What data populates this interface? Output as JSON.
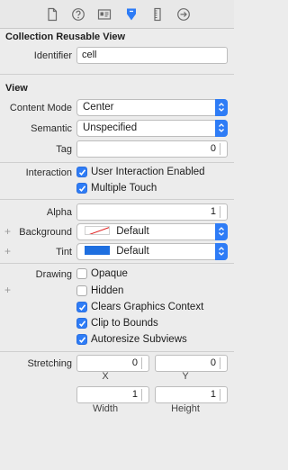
{
  "toolbar": {
    "icons": [
      "file-inspector-icon",
      "quick-help-icon",
      "identity-inspector-icon",
      "attributes-inspector-icon",
      "size-inspector-icon",
      "connections-inspector-icon"
    ],
    "active_color": "#2e7cf6"
  },
  "collection_reusable_view": {
    "title": "Collection Reusable View",
    "identifier_label": "Identifier",
    "identifier_value": "cell"
  },
  "view": {
    "title": "View",
    "content_mode_label": "Content Mode",
    "content_mode_value": "Center",
    "semantic_label": "Semantic",
    "semantic_value": "Unspecified",
    "tag_label": "Tag",
    "tag_value": "0",
    "interaction_label": "Interaction",
    "user_interaction_label": "User Interaction Enabled",
    "user_interaction_checked": true,
    "multiple_touch_label": "Multiple Touch",
    "multiple_touch_checked": true,
    "alpha_label": "Alpha",
    "alpha_value": "1",
    "background_label": "Background",
    "background_value": "Default",
    "tint_label": "Tint",
    "tint_value": "Default",
    "tint_color": "#1e6fe0",
    "drawing_label": "Drawing",
    "opaque_label": "Opaque",
    "opaque_checked": false,
    "hidden_label": "Hidden",
    "hidden_checked": false,
    "clears_graphics_label": "Clears Graphics Context",
    "clears_graphics_checked": true,
    "clip_to_bounds_label": "Clip to Bounds",
    "clip_to_bounds_checked": true,
    "autoresize_label": "Autoresize Subviews",
    "autoresize_checked": true,
    "stretching_label": "Stretching",
    "stretch_x_value": "0",
    "stretch_y_value": "0",
    "stretch_width_value": "1",
    "stretch_height_value": "1",
    "x_label": "X",
    "y_label": "Y",
    "width_label": "Width",
    "height_label": "Height"
  }
}
